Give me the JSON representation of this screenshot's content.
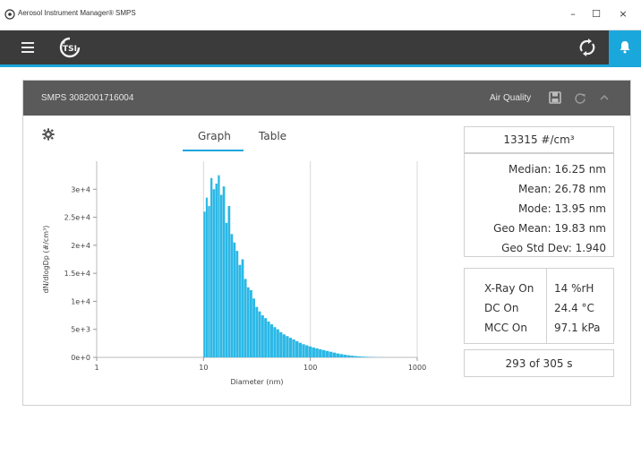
{
  "window": {
    "title": "Aerosol Instrument Manager® SMPS",
    "min": "–",
    "max": "☐",
    "close": "×"
  },
  "appbar": {
    "menu_icon": "hamburger-icon",
    "logo": "TSI",
    "sync_icon": "sync-icon",
    "notify_icon": "bell-icon",
    "accent": "#1aa7dc",
    "bg": "#3b3b3b"
  },
  "instrument": {
    "name": "SMPS 3082001716004",
    "mode": "Air Quality"
  },
  "tabs": [
    {
      "label": "Graph",
      "active": true
    },
    {
      "label": "Table",
      "active": false
    }
  ],
  "chart_data": {
    "type": "bar",
    "xlabel": "Diameter (nm)",
    "ylabel": "dN/dlogDp (#/cm³)",
    "xscale": "log",
    "xlim": [
      1,
      1000
    ],
    "xticks": [
      "1",
      "10",
      "100",
      "1000"
    ],
    "ylim": [
      0,
      35000
    ],
    "yticks": [
      "0e+0",
      "5e+3",
      "1e+4",
      "1.5e+4",
      "2e+4",
      "2.5e+4",
      "3e+4"
    ],
    "bar_color": "#2bb8e6",
    "x": [
      10.0,
      10.5,
      11.0,
      11.6,
      12.2,
      12.9,
      13.6,
      14.3,
      15.1,
      16.0,
      16.9,
      17.9,
      19.0,
      20.1,
      21.3,
      22.6,
      24.0,
      25.5,
      27.1,
      28.8,
      30.6,
      32.6,
      34.7,
      37.0,
      39.5,
      42.1,
      45.0,
      48.1,
      51.4,
      55.0,
      58.9,
      63.1,
      67.6,
      72.5,
      77.8,
      83.5,
      89.7,
      96.4,
      103.6,
      111.4,
      119.9,
      129.1,
      139.1,
      150.0,
      161.8,
      174.6,
      188.5,
      203.6,
      220.0,
      237.8,
      257.1,
      278.1,
      300.8,
      325.5,
      352.3,
      381.4,
      412.9,
      447.1,
      484.2,
      524.4
    ],
    "values": [
      26000,
      28500,
      27000,
      32000,
      30000,
      31000,
      32500,
      29000,
      30500,
      24000,
      27000,
      22000,
      20500,
      19000,
      16500,
      17500,
      14000,
      12500,
      12000,
      10500,
      9000,
      8200,
      7500,
      7000,
      6400,
      5900,
      5400,
      5000,
      4500,
      4100,
      3800,
      3500,
      3200,
      2900,
      2600,
      2350,
      2150,
      1950,
      1750,
      1600,
      1450,
      1300,
      1150,
      1000,
      850,
      700,
      580,
      470,
      380,
      300,
      230,
      180,
      130,
      100,
      70,
      50,
      35,
      22,
      12,
      5
    ]
  },
  "concentration": "13315 #/cm³",
  "stats": [
    {
      "label": "Median:",
      "value": "16.25 nm"
    },
    {
      "label": "Mean:",
      "value": "26.78 nm"
    },
    {
      "label": "Mode:",
      "value": "13.95 nm"
    },
    {
      "label": "Geo Mean:",
      "value": "19.83 nm"
    },
    {
      "label": "Geo Std Dev:",
      "value": "1.940"
    }
  ],
  "env": [
    {
      "label": "X-Ray On",
      "value": "14 %rH"
    },
    {
      "label": "DC On",
      "value": "24.4 °C"
    },
    {
      "label": "MCC On",
      "value": "97.1 kPa"
    }
  ],
  "scan_time": "293 of 305 s"
}
